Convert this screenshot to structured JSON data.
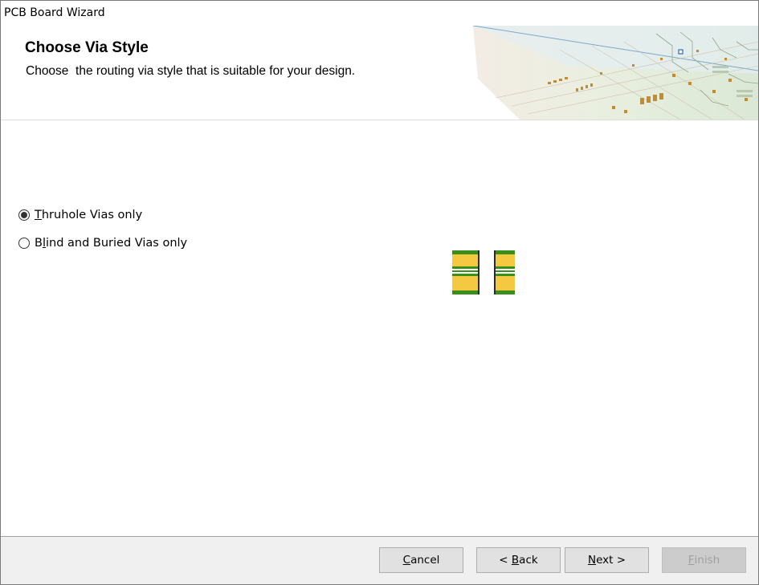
{
  "window": {
    "title": "PCB Board Wizard"
  },
  "header": {
    "title": "Choose Via Style",
    "subtitle": "Choose  the routing via style that is suitable for your design."
  },
  "options": {
    "thruhole": {
      "mnemonic": "T",
      "rest": "hruhole Vias only",
      "selected": true
    },
    "blind": {
      "before": "B",
      "mnemonic": "l",
      "rest": "ind and Buried Vias only",
      "selected": false
    }
  },
  "footer": {
    "cancel": {
      "mnemonic": "C",
      "rest": "ancel"
    },
    "back": {
      "prefix": "< ",
      "mnemonic": "B",
      "rest": "ack"
    },
    "next": {
      "mnemonic": "N",
      "rest": "ext >"
    },
    "finish": {
      "mnemonic": "F",
      "rest": "inish",
      "enabled": false
    }
  },
  "colors": {
    "via_copper": "#f5c842",
    "via_green": "#3a8f1a"
  }
}
